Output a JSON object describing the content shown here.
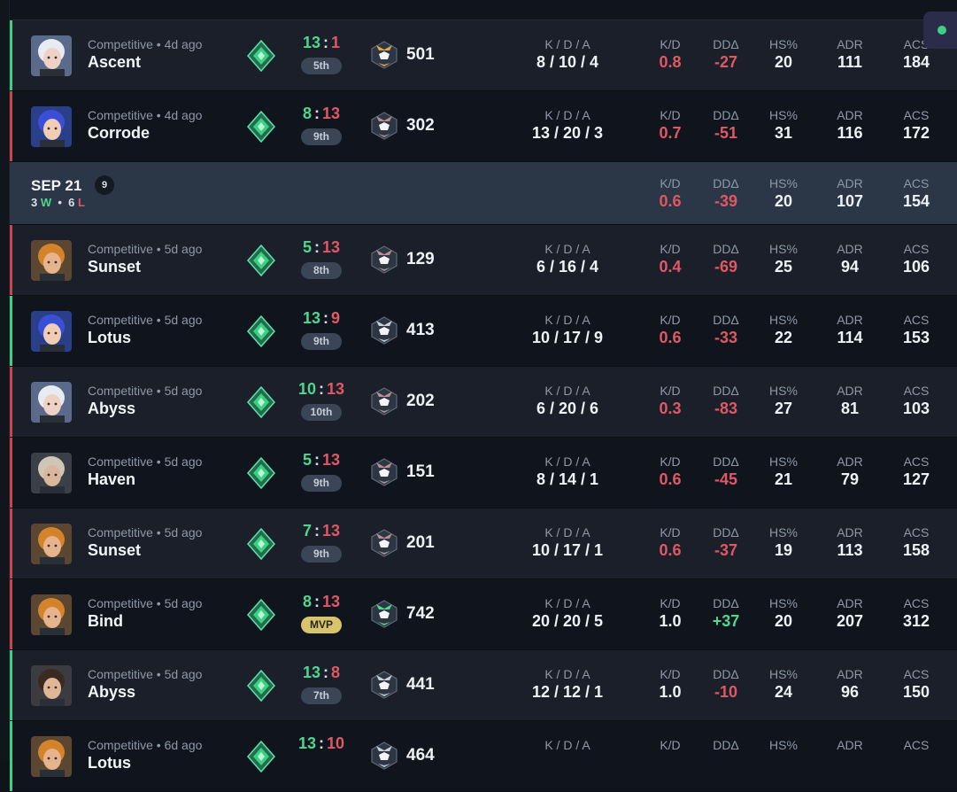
{
  "colors": {
    "win": "#3fcf83",
    "loss": "#c8444e",
    "positive": "#4fd68f",
    "negative": "#e05863",
    "mvp": "#d7c46d"
  },
  "headers": {
    "kda": "K / D / A",
    "kd": "K/D",
    "dd": "DDΔ",
    "hs": "HS%",
    "adr": "ADR",
    "acs": "ACS"
  },
  "matches_before": [
    {
      "result": "win",
      "agent_icon": "agent-portrait-white-hair",
      "mode": "Competitive • 4d ago",
      "map": "Ascent",
      "score_us": "13",
      "score_them": "1",
      "placement": "5th",
      "mvp": false,
      "rr": "501",
      "rank_badge": "tier-badge-gold",
      "kda": "8 / 10 / 4",
      "kd": "0.8",
      "dd": "-27",
      "hs": "20",
      "adr": "111",
      "acs": "184"
    },
    {
      "result": "loss",
      "agent_icon": "agent-portrait-blue-hair",
      "mode": "Competitive • 4d ago",
      "map": "Corrode",
      "score_us": "8",
      "score_them": "13",
      "placement": "9th",
      "mvp": false,
      "rr": "302",
      "rank_badge": "tier-badge-gray",
      "kda": "13 / 20 / 3",
      "kd": "0.7",
      "dd": "-51",
      "hs": "31",
      "adr": "116",
      "acs": "172"
    }
  ],
  "day": {
    "date": "SEP 21",
    "count": "9",
    "wins": "3",
    "w": "W",
    "sep": "•",
    "losses": "6",
    "l": "L",
    "kd": "0.6",
    "dd": "-39",
    "hs": "20",
    "adr": "107",
    "acs": "154"
  },
  "matches": [
    {
      "result": "loss",
      "agent_icon": "agent-portrait-orange-hair",
      "mode": "Competitive • 5d ago",
      "map": "Sunset",
      "score_us": "5",
      "score_them": "13",
      "placement": "8th",
      "mvp": false,
      "rr": "129",
      "rank_badge": "tier-badge-gray",
      "kda": "6 / 16 / 4",
      "kd": "0.4",
      "dd": "-69",
      "hs": "25",
      "adr": "94",
      "acs": "106"
    },
    {
      "result": "win",
      "agent_icon": "agent-portrait-blue-hair",
      "mode": "Competitive • 5d ago",
      "map": "Lotus",
      "score_us": "13",
      "score_them": "9",
      "placement": "9th",
      "mvp": false,
      "rr": "413",
      "rank_badge": "tier-badge-silver",
      "kda": "10 / 17 / 9",
      "kd": "0.6",
      "dd": "-33",
      "hs": "22",
      "adr": "114",
      "acs": "153"
    },
    {
      "result": "loss",
      "agent_icon": "agent-portrait-white-hair",
      "mode": "Competitive • 5d ago",
      "map": "Abyss",
      "score_us": "10",
      "score_them": "13",
      "placement": "10th",
      "mvp": false,
      "rr": "202",
      "rank_badge": "tier-badge-gray",
      "kda": "6 / 20 / 6",
      "kd": "0.3",
      "dd": "-83",
      "hs": "27",
      "adr": "81",
      "acs": "103"
    },
    {
      "result": "loss",
      "agent_icon": "agent-portrait-hat",
      "mode": "Competitive • 5d ago",
      "map": "Haven",
      "score_us": "5",
      "score_them": "13",
      "placement": "9th",
      "mvp": false,
      "rr": "151",
      "rank_badge": "tier-badge-gray",
      "kda": "8 / 14 / 1",
      "kd": "0.6",
      "dd": "-45",
      "hs": "21",
      "adr": "79",
      "acs": "127"
    },
    {
      "result": "loss",
      "agent_icon": "agent-portrait-orange-hair",
      "mode": "Competitive • 5d ago",
      "map": "Sunset",
      "score_us": "7",
      "score_them": "13",
      "placement": "9th",
      "mvp": false,
      "rr": "201",
      "rank_badge": "tier-badge-gray",
      "kda": "10 / 17 / 1",
      "kd": "0.6",
      "dd": "-37",
      "hs": "19",
      "adr": "113",
      "acs": "158"
    },
    {
      "result": "loss",
      "agent_icon": "agent-portrait-orange-hair",
      "mode": "Competitive • 5d ago",
      "map": "Bind",
      "score_us": "8",
      "score_them": "13",
      "placement": "MVP",
      "mvp": true,
      "rr": "742",
      "rank_badge": "tier-badge-green",
      "kda": "20 / 20 / 5",
      "kd": "1.0",
      "dd": "+37",
      "hs": "20",
      "adr": "207",
      "acs": "312"
    },
    {
      "result": "win",
      "agent_icon": "agent-portrait-dark-hair",
      "mode": "Competitive • 5d ago",
      "map": "Abyss",
      "score_us": "13",
      "score_them": "8",
      "placement": "7th",
      "mvp": false,
      "rr": "441",
      "rank_badge": "tier-badge-silver",
      "kda": "12 / 12 / 1",
      "kd": "1.0",
      "dd": "-10",
      "hs": "24",
      "adr": "96",
      "acs": "150"
    },
    {
      "result": "win",
      "agent_icon": "agent-portrait-orange-hair",
      "mode": "Competitive • 6d ago",
      "map": "Lotus",
      "score_us": "13",
      "score_them": "10",
      "placement": "",
      "mvp": false,
      "rr": "464",
      "rank_badge": "tier-badge-silver",
      "kda": "",
      "kd": "",
      "dd": "",
      "hs": "",
      "adr": "",
      "acs": ""
    }
  ]
}
